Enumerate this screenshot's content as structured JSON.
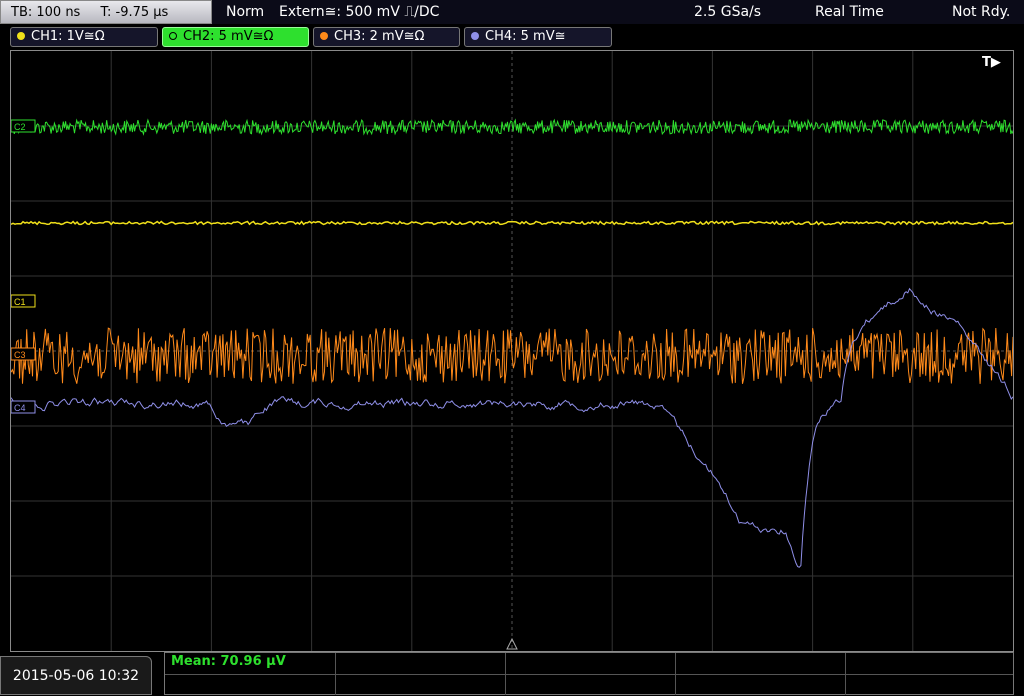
{
  "top": {
    "timebase": "TB: 100 ns",
    "trigger_time": "T: -9.75 µs",
    "mode": "Norm",
    "trigger": "Extern≅: 500 mV ⎍/DC",
    "sample_rate": "2.5 GSa/s",
    "acq_mode": "Real Time",
    "status": "Not Rdy."
  },
  "channels": [
    {
      "label": "CH1: 1V≅Ω",
      "color": "#f0e01a",
      "active": false
    },
    {
      "label": "CH2: 5 mV≅Ω",
      "color": "#2ee02e",
      "active": true
    },
    {
      "label": "CH3: 2 mV≅Ω",
      "color": "#ff8a1a",
      "active": false
    },
    {
      "label": "CH4: 5 mV≅",
      "color": "#8f8fe8",
      "active": false
    }
  ],
  "markers": {
    "trigger": "T▶",
    "c1": "C1",
    "c2": "C2",
    "c3": "C3",
    "c4": "C4"
  },
  "footer": {
    "datetime": "2015-05-06 10:32",
    "mean": "Mean: 70.96 µV"
  },
  "colors": {
    "ch1": "#f0e01a",
    "ch2": "#2ee02e",
    "ch3": "#ff8a1a",
    "ch4": "#8f8fe8",
    "grid": "#3a3a3a"
  }
}
